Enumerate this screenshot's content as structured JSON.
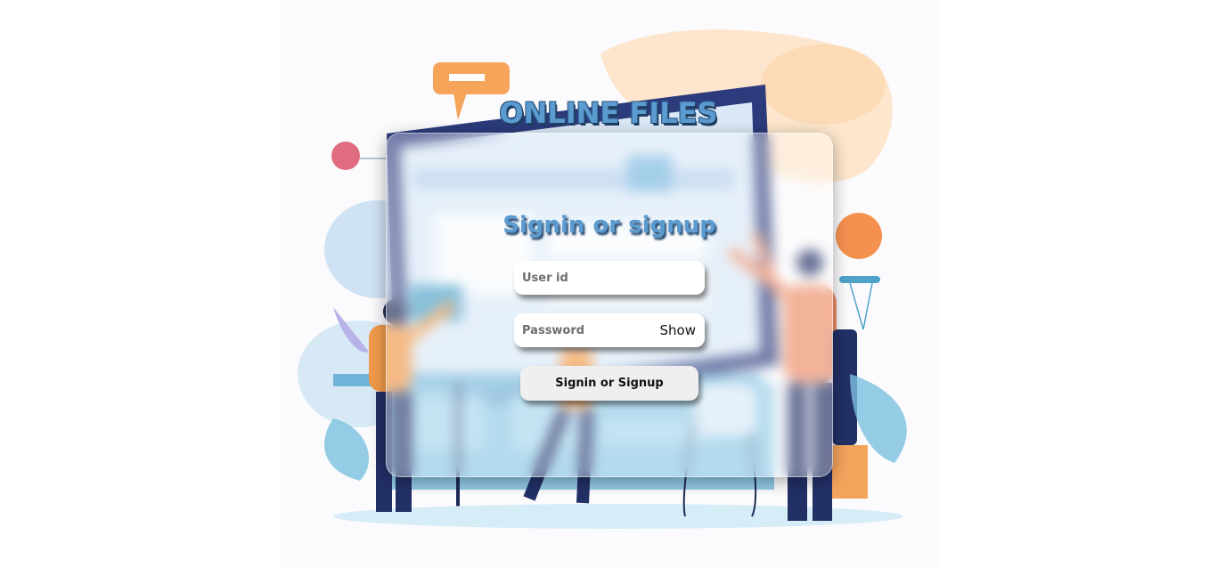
{
  "app": {
    "title": "ONLINE FILES"
  },
  "login": {
    "heading": "Signin or signup",
    "user_id": {
      "value": "",
      "placeholder": "User id"
    },
    "password": {
      "value": "",
      "placeholder": "Password",
      "toggle_label": "Show"
    },
    "submit_label": "Signin or Signup"
  },
  "colors": {
    "title_fill": "#5b9bd0",
    "title_shadow": "#1f3f63",
    "button_bg": "#efefef",
    "field_bg": "#ffffff"
  },
  "icons": {
    "background": "office-collaboration-illustration"
  }
}
